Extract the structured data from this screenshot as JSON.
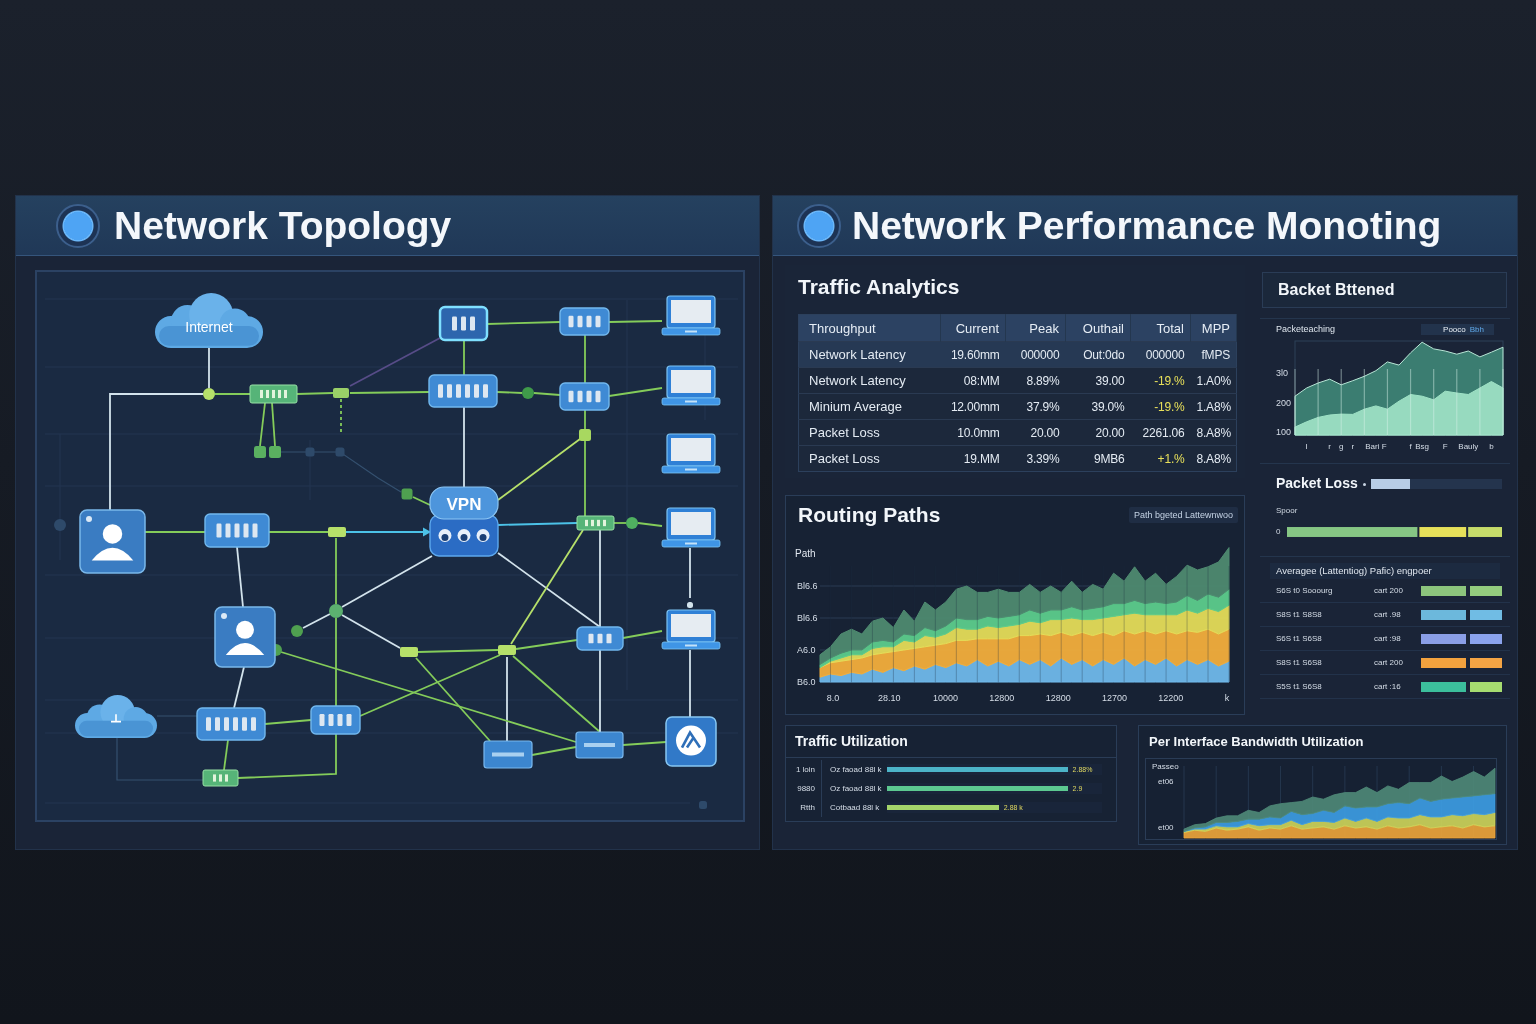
{
  "topology": {
    "title": "Network Topology",
    "nodes": [
      {
        "kind": "cloud",
        "label": "Internet"
      },
      {
        "kind": "gateway"
      },
      {
        "kind": "switch"
      },
      {
        "kind": "laptop"
      },
      {
        "kind": "tag"
      },
      {
        "kind": "switch"
      },
      {
        "kind": "switch"
      },
      {
        "kind": "laptop"
      },
      {
        "kind": "laptop"
      },
      {
        "kind": "user"
      },
      {
        "kind": "switch"
      },
      {
        "kind": "vpn",
        "label": "VPN"
      },
      {
        "kind": "tag"
      },
      {
        "kind": "laptop"
      },
      {
        "kind": "user"
      },
      {
        "kind": "switch"
      },
      {
        "kind": "laptop"
      },
      {
        "kind": "cloud"
      },
      {
        "kind": "switch"
      },
      {
        "kind": "switch"
      },
      {
        "kind": "panel"
      },
      {
        "kind": "panel"
      },
      {
        "kind": "router"
      },
      {
        "kind": "tag"
      }
    ]
  },
  "performance": {
    "title": "Network Performance Monoting",
    "traffic_analytics": {
      "title": "Traffic Analytics",
      "columns": [
        "Throughput",
        "Current",
        "Peak",
        "Outhail",
        "Total",
        "MPP"
      ],
      "rows": [
        {
          "selected": true,
          "alert": false,
          "cells": [
            "Network Latency",
            "19.60mm",
            "000000",
            "Out:0do",
            "000000",
            "fMPS"
          ]
        },
        {
          "selected": false,
          "alert": true,
          "cells": [
            "Network Latency",
            "08:MM",
            "8.89%",
            "39.00",
            "-19.%",
            "1.A0%"
          ]
        },
        {
          "selected": false,
          "alert": true,
          "cells": [
            "Minium Average",
            "12.00mm",
            "37.9%",
            "39.0%",
            "-19.%",
            "1.A8%"
          ]
        },
        {
          "selected": false,
          "alert": false,
          "cells": [
            "Packet Loss",
            "10.0mm",
            "20.00",
            "20.00",
            "2261.06",
            "8.A8%"
          ]
        },
        {
          "selected": false,
          "alert": true,
          "cells": [
            "Packet Loss",
            "19.MM",
            "3.39%",
            "9MB6",
            "+1.%",
            "8.A8%"
          ]
        }
      ]
    },
    "routing_paths": {
      "title": "Routing Paths",
      "legend": "Path bgeted Lattewnwoo",
      "ylabel": "Path",
      "y_labels": [
        "Bl6.6",
        "Bl6.6",
        "A6.0",
        "B6.0"
      ],
      "x_labels": [
        "8.0",
        "28.10",
        "10000",
        "12800",
        "12800",
        "12700",
        "12200",
        "k"
      ]
    },
    "backet_bttened": {
      "title": "Backet Bttened",
      "legend": [
        "Pooco",
        "Bbh"
      ],
      "chart_data": {
        "type": "area",
        "title": "Packeteaching",
        "categories": [
          null,
          "I",
          null,
          "r",
          "g",
          "r",
          null,
          "Bari F",
          null,
          null,
          "f",
          "Bsg",
          null,
          "F",
          null,
          "Bauly",
          null,
          "b",
          null
        ],
        "ylim": [
          90,
          410
        ],
        "yticks": [
          {
            "value": 300,
            "label": "3l0"
          },
          {
            "value": 200,
            "label": "200"
          },
          {
            "value": 100,
            "label": "100"
          }
        ],
        "grid": true,
        "stacked": false,
        "series": [
          {
            "color": "#3e8576",
            "values": [
              222,
              250,
              267,
              280,
              261,
              275,
              290,
              309,
              339,
              328,
              370,
              406,
              383,
              376,
              365,
              376,
              356,
              372,
              389
            ]
          },
          {
            "color": "#9fe2c6",
            "values": [
              117,
              135,
              150,
              158,
              161,
              160,
              178,
              189,
              178,
              205,
              228,
              222,
              210,
              239,
              233,
              228,
              250,
              272,
              250
            ]
          }
        ]
      }
    },
    "packet_loss": {
      "title": "Packet Loss",
      "level": 0.3,
      "label": "Spoor",
      "row_label": "0"
    },
    "averages": {
      "title": "Averagee (Lattentiog) Pafic) engpoer",
      "rows": [
        {
          "label": "S6S t0 Sooourg",
          "value": "cart 200",
          "bars": [
            {
              "color": "#8cc47c"
            },
            {
              "color": "#94cc7e"
            }
          ]
        },
        {
          "label": "S8S t1 S8S8",
          "value": "cart .98",
          "bars": [
            {
              "color": "#6cb8dc"
            },
            {
              "color": "#70bce4"
            }
          ]
        },
        {
          "label": "S6S t1 S6S8",
          "value": "cart :98",
          "bars": [
            {
              "color": "#8a9ee6"
            },
            {
              "color": "#8aa2ec"
            }
          ]
        },
        {
          "label": "S8S t1 S6S8",
          "value": "cart 200",
          "bars": [
            {
              "color": "#f2a23e"
            },
            {
              "color": "#f4a444"
            }
          ]
        },
        {
          "label": "S5S t1 S6S8",
          "value": "cart :16",
          "bars": [
            {
              "color": "#3cbf9c"
            },
            {
              "color": "#a6dc70"
            }
          ]
        }
      ]
    },
    "traffic_utilization": {
      "title": "Traffic Utilization",
      "rows": [
        {
          "label": "1 loin",
          "name": "Oz faoad 88l k",
          "level": 0.84,
          "reading": "2.88%",
          "color": "#4cb4c8"
        },
        {
          "label": "9880",
          "name": "Oz faoad 88l k",
          "level": 0.84,
          "reading": "2.9",
          "color": "#5cc890"
        },
        {
          "label": "Rtth",
          "name": "Cotbaad 88l k",
          "level": 0.52,
          "reading": "2.88 k",
          "color": "#a4d46a"
        }
      ]
    },
    "bandwidth": {
      "title": "Per Interface Bandwidth Utilization",
      "ylabel": "Passeo",
      "y_labels": [
        "et06",
        "et00"
      ]
    }
  }
}
